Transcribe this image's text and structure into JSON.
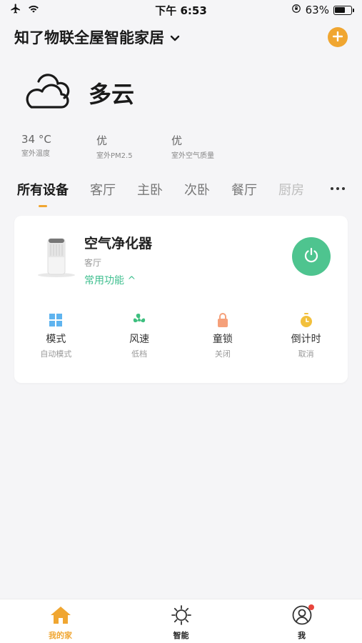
{
  "status_bar": {
    "time": "下午 6:53",
    "battery": "63%",
    "battery_level": 0.63
  },
  "header": {
    "title": "知了物联全屋智能家居",
    "dropdown_icon": "chevron-down-icon",
    "add_icon": "plus-icon",
    "accent_color": "#f0a631"
  },
  "weather": {
    "condition": "多云",
    "icon": "cloud-icon",
    "stats": [
      {
        "value": "34 °C",
        "label": "室外温度"
      },
      {
        "value": "优",
        "label": "室外PM2.5"
      },
      {
        "value": "优",
        "label": "室外空气质量"
      }
    ]
  },
  "tabs": [
    {
      "label": "所有设备"
    },
    {
      "label": "客厅"
    },
    {
      "label": "主卧"
    },
    {
      "label": "次卧"
    },
    {
      "label": "餐厅"
    },
    {
      "label": "厨房"
    }
  ],
  "device": {
    "name": "空气净化器",
    "room": "客厅",
    "functions_link": "常用功能 ^",
    "power_color": "#4ec48f",
    "controls": [
      {
        "label": "模式",
        "value": "自动模式",
        "icon": "grid-icon"
      },
      {
        "label": "风速",
        "value": "低档",
        "icon": "fan-icon"
      },
      {
        "label": "童锁",
        "value": "关闭",
        "icon": "lock-icon"
      },
      {
        "label": "倒计时",
        "value": "取消",
        "icon": "timer-icon"
      }
    ]
  },
  "bottom_nav": [
    {
      "label": "我的家",
      "icon": "home-icon"
    },
    {
      "label": "智能",
      "icon": "sun-icon"
    },
    {
      "label": "我",
      "icon": "profile-icon"
    }
  ]
}
